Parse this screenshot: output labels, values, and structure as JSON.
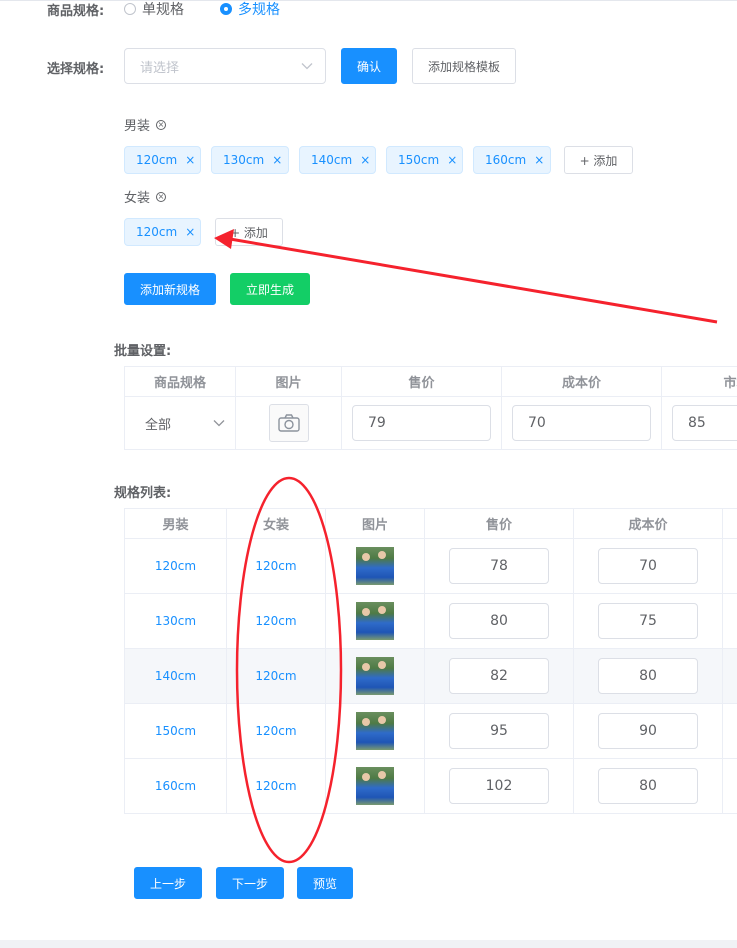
{
  "spec_type": {
    "label": "商品规格:",
    "options": [
      {
        "label": "单规格",
        "selected": false
      },
      {
        "label": "多规格",
        "selected": true
      }
    ]
  },
  "choose_spec": {
    "label": "选择规格:",
    "placeholder": "请选择",
    "confirm": "确认",
    "add_template": "添加规格模板"
  },
  "groups": [
    {
      "name": "男装",
      "values": [
        "120cm",
        "130cm",
        "140cm",
        "150cm",
        "160cm"
      ],
      "add_label": "+ 添加"
    },
    {
      "name": "女装",
      "values": [
        "120cm"
      ],
      "add_label": "+ 添加"
    }
  ],
  "actions": {
    "add_new_spec": "添加新规格",
    "generate_now": "立即生成"
  },
  "batch": {
    "title": "批量设置:",
    "headers": [
      "商品规格",
      "图片",
      "售价",
      "成本价",
      "市场价"
    ],
    "all_label": "全部",
    "sale_price": "79",
    "cost_price": "70",
    "market_price": "85"
  },
  "spec_list": {
    "title": "规格列表:",
    "headers": [
      "男装",
      "女装",
      "图片",
      "售价",
      "成本价"
    ],
    "rows": [
      {
        "male": "120cm",
        "female": "120cm",
        "price": "78",
        "cost": "70"
      },
      {
        "male": "130cm",
        "female": "120cm",
        "price": "80",
        "cost": "75"
      },
      {
        "male": "140cm",
        "female": "120cm",
        "price": "82",
        "cost": "80"
      },
      {
        "male": "150cm",
        "female": "120cm",
        "price": "95",
        "cost": "90"
      },
      {
        "male": "160cm",
        "female": "120cm",
        "price": "102",
        "cost": "80"
      }
    ]
  },
  "footer": {
    "prev": "上一步",
    "next": "下一步",
    "preview": "预览"
  },
  "colors": {
    "primary": "#1890ff",
    "success": "#13ce66",
    "annotation": "#f5222d"
  }
}
